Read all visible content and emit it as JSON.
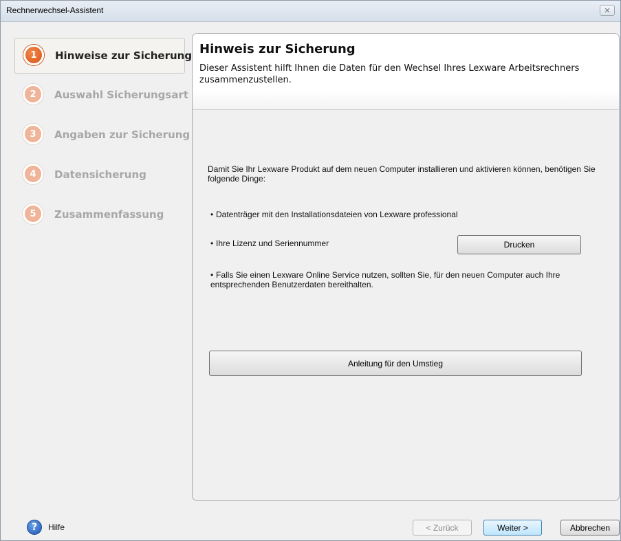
{
  "window": {
    "title": "Rechnerwechsel-Assistent",
    "close_symbol": "✕"
  },
  "steps": [
    {
      "number": "1",
      "label": "Hinweise zur Sicherung",
      "active": true
    },
    {
      "number": "2",
      "label": "Auswahl Sicherungsart",
      "active": false
    },
    {
      "number": "3",
      "label": "Angaben zur Sicherung",
      "active": false
    },
    {
      "number": "4",
      "label": "Datensicherung",
      "active": false
    },
    {
      "number": "5",
      "label": "Zusammenfassung",
      "active": false
    }
  ],
  "content": {
    "title": "Hinweis zur Sicherung",
    "description": "Dieser Assistent hilft Ihnen die Daten für den Wechsel Ihres Lexware Arbeitsrechners zusammenzustellen.",
    "intro": "Damit Sie Ihr Lexware Produkt auf dem neuen Computer installieren und aktivieren können, benötigen Sie folgende Dinge:",
    "bullet_symbol": "•",
    "bullets": [
      "Datenträger mit den Installationsdateien von Lexware professional",
      "Ihre Lizenz und Seriennummer",
      "Falls Sie einen Lexware Online Service nutzen, sollten Sie, für den neuen Computer auch Ihre entsprechenden Benutzerdaten bereithalten."
    ],
    "print_button": "Drucken",
    "guide_button": "Anleitung für den Umstieg"
  },
  "footer": {
    "help_icon_glyph": "?",
    "help_label": "Hilfe",
    "back_button": "< Zurück",
    "next_button": "Weiter >",
    "cancel_button": "Abbrechen"
  },
  "colors": {
    "active_step": "#d85416",
    "inactive_step": "#efb59b",
    "help_icon": "#1e55b3"
  }
}
